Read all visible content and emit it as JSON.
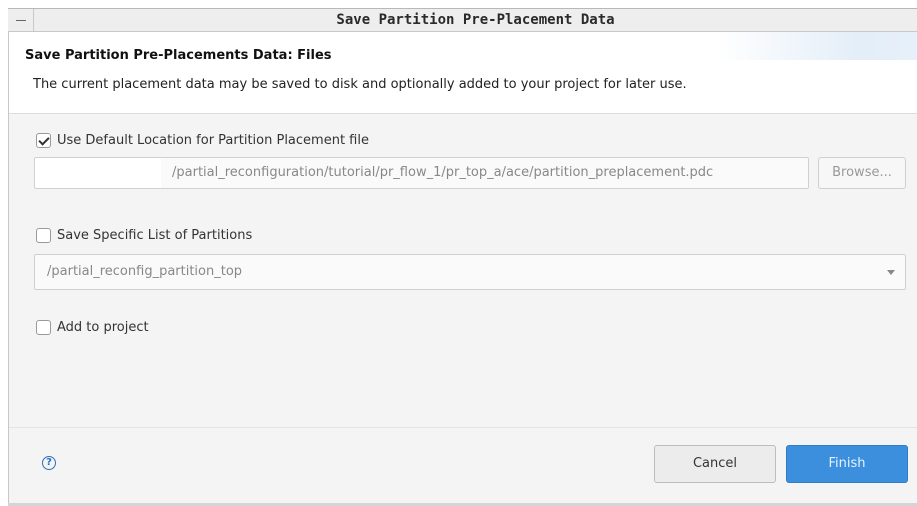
{
  "window": {
    "title": "Save Partition Pre-Placement Data",
    "menu_icon": "window-menu-icon"
  },
  "banner": {
    "title": "Save Partition Pre-Placements Data: Files",
    "description": "The current placement data may be saved to disk and optionally added to your project for later use."
  },
  "default_location": {
    "label": "Use Default Location for Partition Placement file",
    "checked": true,
    "path": "/partial_reconfiguration/tutorial/pr_flow_1/pr_top_a/ace/partition_preplacement.pdc",
    "browse_label": "Browse..."
  },
  "partitions": {
    "label": "Save Specific List of Partitions",
    "checked": false,
    "selected": "/partial_reconfig_partition_top"
  },
  "add_to_project": {
    "label": "Add to project",
    "checked": false
  },
  "footer": {
    "help_icon": "help-icon",
    "help_glyph": "?",
    "cancel_label": "Cancel",
    "finish_label": "Finish"
  },
  "colors": {
    "finish_button": "#3b8fdc",
    "help_icon": "#2a6fc0",
    "content_bg": "#f4f4f4"
  }
}
